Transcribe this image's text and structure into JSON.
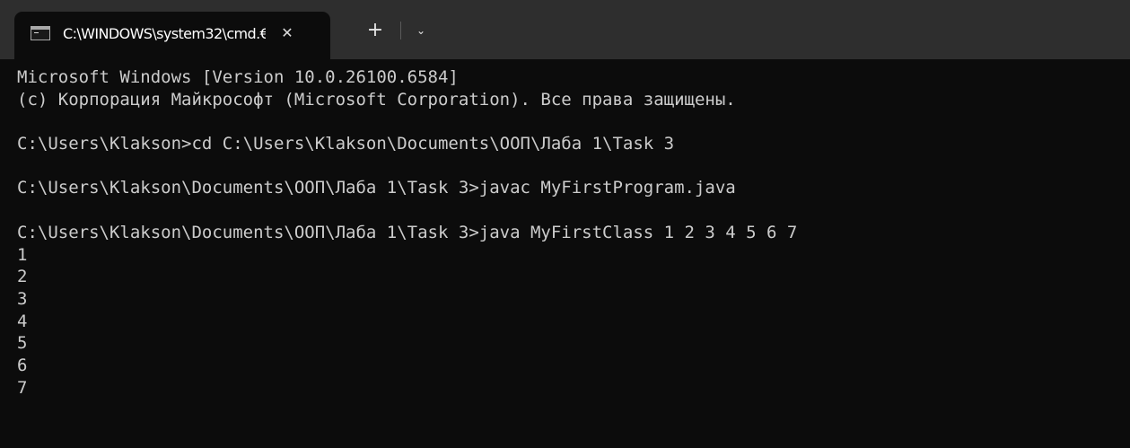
{
  "tab": {
    "title": "C:\\WINDOWS\\system32\\cmd.€",
    "icon": "terminal-icon",
    "close_glyph": "✕"
  },
  "tabbar": {
    "new_tab_glyph": "+",
    "dropdown_glyph": "⌄"
  },
  "colors": {
    "background": "#0c0c0c",
    "tabbar": "#2e2e2e",
    "text": "#cccccc"
  },
  "terminal": {
    "lines": [
      "Microsoft Windows [Version 10.0.26100.6584]",
      "(c) Корпорация Майкрософт (Microsoft Corporation). Все права защищены.",
      "",
      "C:\\Users\\Klakson>cd C:\\Users\\Klakson\\Documents\\ООП\\Лаба 1\\Task 3",
      "",
      "C:\\Users\\Klakson\\Documents\\ООП\\Лаба 1\\Task 3>javac MyFirstProgram.java",
      "",
      "C:\\Users\\Klakson\\Documents\\ООП\\Лаба 1\\Task 3>java MyFirstClass 1 2 3 4 5 6 7",
      "1",
      "2",
      "3",
      "4",
      "5",
      "6",
      "7"
    ]
  }
}
